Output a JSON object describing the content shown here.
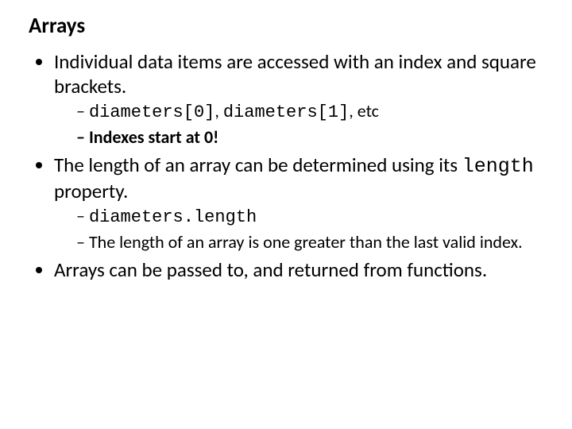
{
  "slide": {
    "title": "Arrays",
    "bullets": {
      "b1": {
        "text": "Individual data items are accessed with an index and square brackets.",
        "sub": {
          "s1": {
            "code1": "diameters[0]",
            "sep": ", ",
            "code2": "diameters[1]",
            "tail": ", etc"
          },
          "s2": {
            "text": "Indexes start at 0!"
          }
        }
      },
      "b2": {
        "lead": "The length of an array can be determined using its ",
        "code": "length",
        "tail": " property.",
        "sub": {
          "s1": {
            "code": "diameters.length"
          },
          "s2": {
            "text": "The length of an array is one greater than the last valid index."
          }
        }
      },
      "b3": {
        "text": "Arrays can be passed to, and returned from functions."
      }
    }
  }
}
